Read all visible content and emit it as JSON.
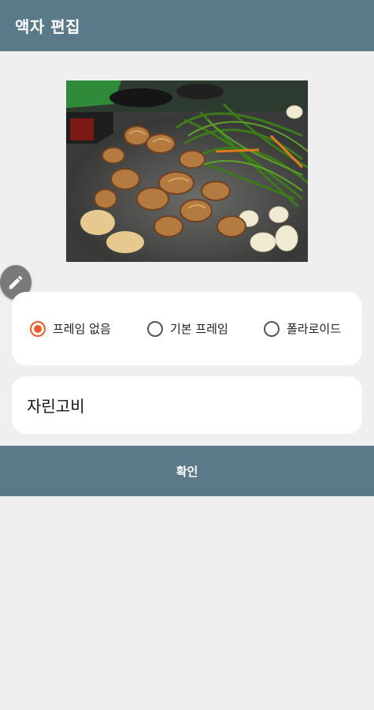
{
  "app_bar": {
    "title": "액자 편집"
  },
  "photo": {
    "description_icon": "food-photo"
  },
  "edit_button": {
    "icon": "pencil-icon"
  },
  "frame_options": [
    {
      "label": "프레임 없음",
      "checked": true
    },
    {
      "label": "기본 프레임",
      "checked": false
    },
    {
      "label": "폴라로이드",
      "checked": false
    }
  ],
  "title_field": {
    "value": "자린고비"
  },
  "confirm_button": {
    "label": "확인"
  },
  "colors": {
    "app_bar": "#5a7a8a",
    "accent": "#f05a28",
    "background": "#efefef"
  }
}
